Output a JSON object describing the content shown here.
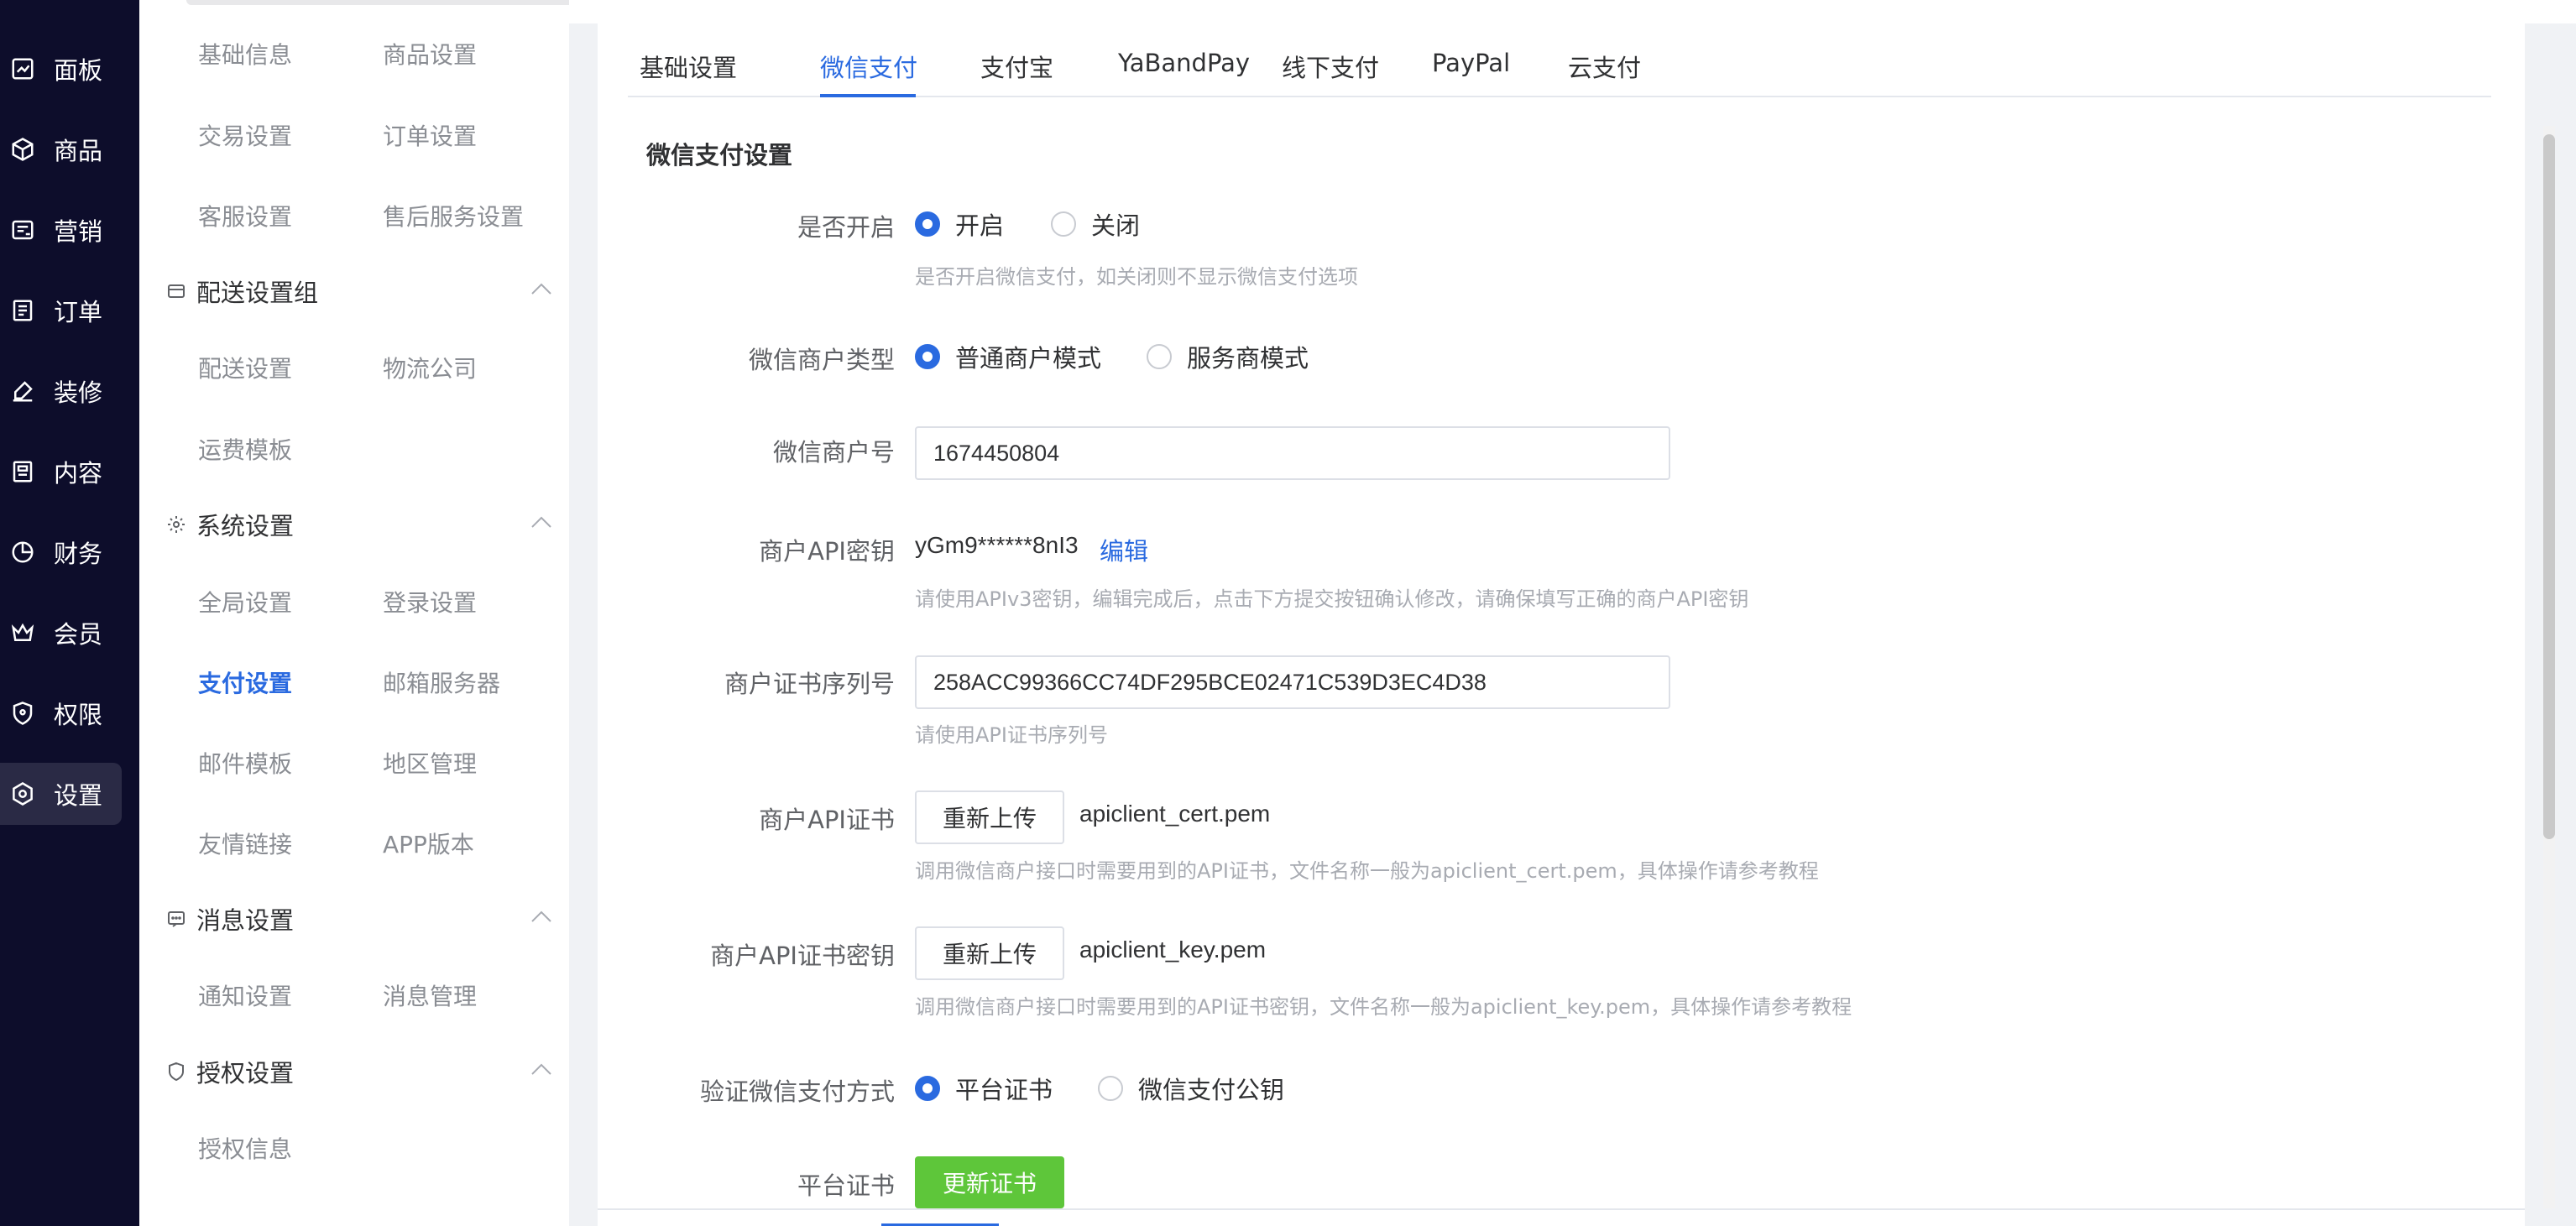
{
  "nav": {
    "items": [
      {
        "label": "面板",
        "icon": "chart-icon"
      },
      {
        "label": "商品",
        "icon": "box-icon"
      },
      {
        "label": "营销",
        "icon": "marketing-icon"
      },
      {
        "label": "订单",
        "icon": "order-icon"
      },
      {
        "label": "装修",
        "icon": "brush-icon"
      },
      {
        "label": "内容",
        "icon": "content-icon"
      },
      {
        "label": "财务",
        "icon": "finance-icon"
      },
      {
        "label": "会员",
        "icon": "crown-icon"
      },
      {
        "label": "权限",
        "icon": "shield-icon"
      },
      {
        "label": "设置",
        "icon": "settings-icon"
      }
    ]
  },
  "submenu": {
    "basic": [
      "基础信息",
      "商品设置",
      "交易设置",
      "订单设置",
      "客服设置",
      "售后服务设置"
    ],
    "delivery_group": {
      "title": "配送设置组",
      "items": [
        "配送设置",
        "物流公司",
        "运费模板"
      ]
    },
    "system_group": {
      "title": "系统设置",
      "items": [
        "全局设置",
        "登录设置",
        "支付设置",
        "邮箱服务器",
        "邮件模板",
        "地区管理",
        "友情链接",
        "APP版本"
      ]
    },
    "message_group": {
      "title": "消息设置",
      "items": [
        "通知设置",
        "消息管理"
      ]
    },
    "auth_group": {
      "title": "授权设置",
      "items": [
        "授权信息"
      ]
    }
  },
  "tabs": [
    "基础设置",
    "微信支付",
    "支付宝",
    "YaBandPay",
    "线下支付",
    "PayPal",
    "云支付"
  ],
  "form": {
    "section_title": "微信支付设置",
    "enable": {
      "label": "是否开启",
      "on": "开启",
      "off": "关闭",
      "hint": "是否开启微信支付，如关闭则不显示微信支付选项"
    },
    "merchant_type": {
      "label": "微信商户类型",
      "normal": "普通商户模式",
      "service": "服务商模式"
    },
    "merchant_id": {
      "label": "微信商户号",
      "value": "1674450804"
    },
    "api_key": {
      "label": "商户API密钥",
      "value": "yGm9******8nI3",
      "edit": "编辑",
      "hint": "请使用APIv3密钥，编辑完成后，点击下方提交按钮确认修改，请确保填写正确的商户API密钥"
    },
    "cert_serial": {
      "label": "商户证书序列号",
      "value": "258ACC99366CC74DF295BCE02471C539D3EC4D38",
      "hint": "请使用API证书序列号"
    },
    "api_cert": {
      "label": "商户API证书",
      "button": "重新上传",
      "file": "apiclient_cert.pem",
      "hint": "调用微信商户接口时需要用到的API证书，文件名称一般为apiclient_cert.pem，具体操作请参考教程"
    },
    "api_cert_key": {
      "label": "商户API证书密钥",
      "button": "重新上传",
      "file": "apiclient_key.pem",
      "hint": "调用微信商户接口时需要用到的API证书密钥，文件名称一般为apiclient_key.pem，具体操作请参考教程"
    },
    "verify_method": {
      "label": "验证微信支付方式",
      "platform": "平台证书",
      "public_key": "微信支付公钥"
    },
    "platform_cert": {
      "label": "平台证书",
      "button": "更新证书"
    }
  },
  "colors": {
    "primary": "#2a6ae0",
    "nav_bg": "#0d0d2b",
    "success": "#5ec63a"
  }
}
